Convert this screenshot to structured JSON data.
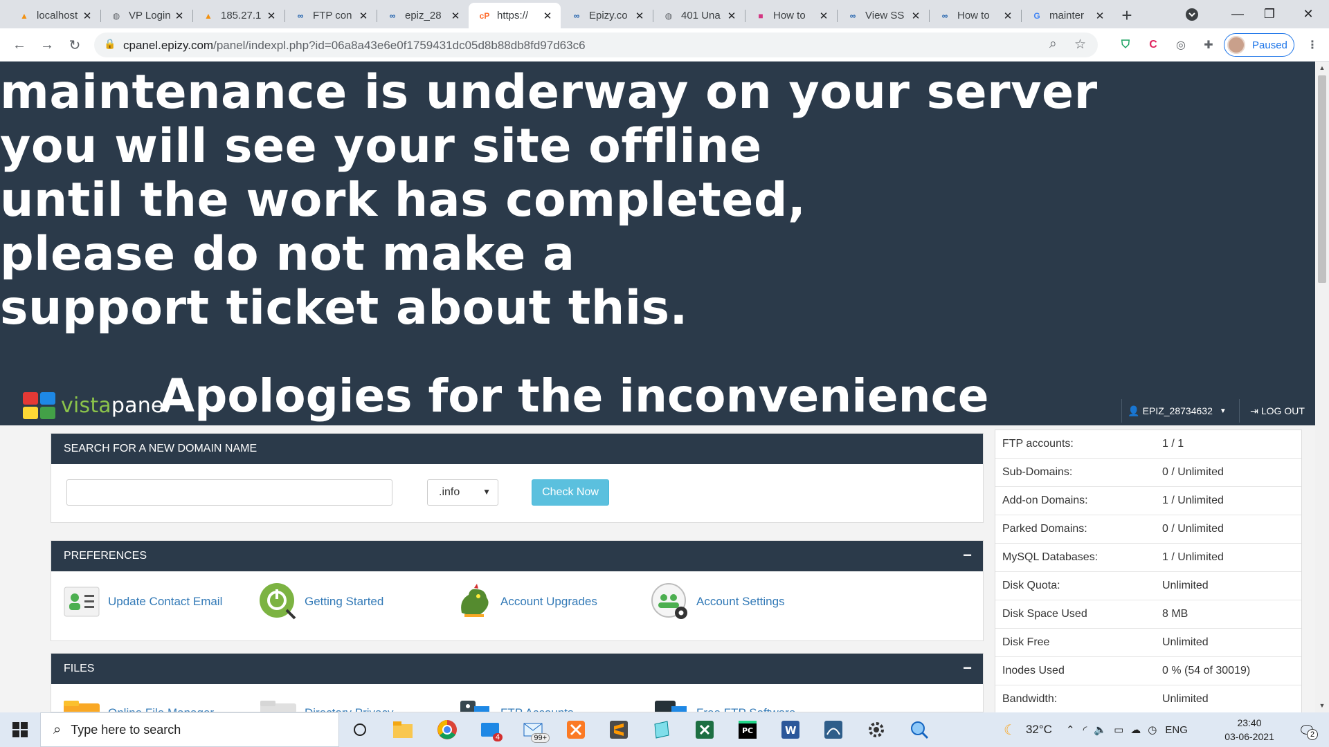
{
  "browser": {
    "tabs": [
      {
        "title": "localhost",
        "icon": "pma-icon",
        "color": "#f29111",
        "active": false
      },
      {
        "title": "VP Login",
        "icon": "globe-icon",
        "color": "#5f6368",
        "active": false
      },
      {
        "title": "185.27.1",
        "icon": "pma-icon",
        "color": "#f29111",
        "active": false
      },
      {
        "title": "FTP con",
        "icon": "infinity-icon",
        "color": "#1a5dab",
        "active": false
      },
      {
        "title": "epiz_28",
        "icon": "infinity-icon",
        "color": "#1a5dab",
        "active": false
      },
      {
        "title": "https://",
        "icon": "cpanel-icon",
        "color": "#ff6c2c",
        "active": true
      },
      {
        "title": "Epizy.co",
        "icon": "infinity-icon",
        "color": "#1a5dab",
        "active": false
      },
      {
        "title": "401 Una",
        "icon": "globe-icon",
        "color": "#5f6368",
        "active": false
      },
      {
        "title": "How to",
        "icon": "stack-icon",
        "color": "#d33682",
        "active": false
      },
      {
        "title": "View SS",
        "icon": "infinity-icon",
        "color": "#1a5dab",
        "active": false
      },
      {
        "title": "How to",
        "icon": "infinity-icon",
        "color": "#1a5dab",
        "active": false
      },
      {
        "title": "mainter",
        "icon": "google-icon",
        "color": "#4285f4",
        "active": false
      }
    ],
    "new_tab": "+",
    "url_host": "cpanel.epizy.com",
    "url_path": "/panel/indexpl.php?id=06a8a43e6e0f1759431dc05d8b88db8fd97d63c6",
    "profile_label": "Paused"
  },
  "banner": {
    "lines": [
      "maintenance is underway on your server",
      "you will see your site offline",
      "until the work has completed,",
      "please do not make a",
      "support ticket about this."
    ],
    "apology": "Apologies for the inconvenience",
    "logo_vista": "vista",
    "logo_panel": "panel",
    "username": "EPIZ_28734632",
    "logout": "LOG OUT"
  },
  "search": {
    "header": "SEARCH FOR A NEW DOMAIN NAME",
    "domain_value": "",
    "tld_selected": ".info",
    "button": "Check Now"
  },
  "preferences": {
    "header": "PREFERENCES",
    "collapse": "−",
    "items": [
      {
        "label": "Update Contact Email",
        "icon": "contact-card-icon"
      },
      {
        "label": "Getting Started",
        "icon": "getting-started-icon"
      },
      {
        "label": "Account Upgrades",
        "icon": "dragon-icon"
      },
      {
        "label": "Account Settings",
        "icon": "account-settings-icon"
      }
    ]
  },
  "files": {
    "header": "FILES",
    "collapse": "−",
    "items": [
      {
        "label": "Online File Manager",
        "icon": "folder-icon"
      },
      {
        "label": "Directory Privacy",
        "icon": "folder-lock-icon"
      },
      {
        "label": "FTP Accounts",
        "icon": "ftp-accounts-icon"
      },
      {
        "label": "Free FTP Software",
        "icon": "ftp-software-icon"
      }
    ]
  },
  "stats": [
    {
      "key": "FTP accounts:",
      "value": "1 / 1"
    },
    {
      "key": "Sub-Domains:",
      "value": "0 / Unlimited"
    },
    {
      "key": "Add-on Domains:",
      "value": "1 / Unlimited"
    },
    {
      "key": "Parked Domains:",
      "value": "0 / Unlimited"
    },
    {
      "key": "MySQL Databases:",
      "value": "1 / Unlimited"
    },
    {
      "key": "Disk Quota:",
      "value": "Unlimited"
    },
    {
      "key": "Disk Space Used",
      "value": "8 MB"
    },
    {
      "key": "Disk Free",
      "value": "Unlimited"
    },
    {
      "key": "Inodes Used",
      "value": "0 % (54 of 30019)"
    },
    {
      "key": "Bandwidth:",
      "value": "Unlimited"
    }
  ],
  "taskbar": {
    "search_placeholder": "Type here to search",
    "mail_badge": "4",
    "mail2_badge": "99+",
    "temperature": "32°C",
    "language": "ENG",
    "time": "23:40",
    "date": "03-06-2021",
    "notification_count": "2"
  },
  "colors": {
    "banner_bg": "#2b3a4a",
    "link": "#337ab7",
    "check_button": "#5bc0de",
    "logo_green": "#8bc34a"
  }
}
